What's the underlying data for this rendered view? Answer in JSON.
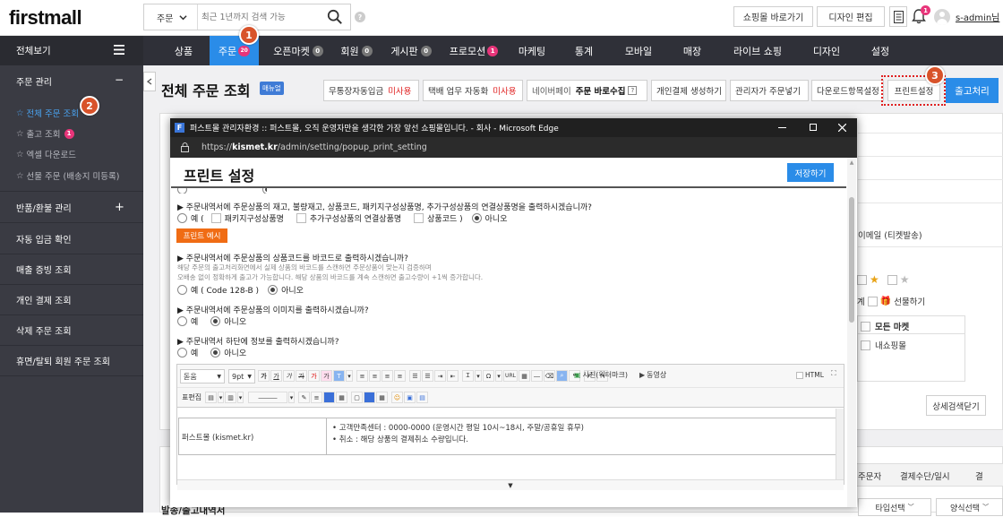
{
  "header": {
    "logo": "firstmall",
    "search_select": "주문",
    "search_placeholder": "최근 1년까지 검색 가능",
    "help": "?",
    "shop_button": "쇼핑몰 바로가기",
    "design_button": "디자인 편집",
    "notification_count": "1",
    "user": "s-admin님"
  },
  "nav": {
    "items": [
      {
        "label": "상품"
      },
      {
        "label": "주문",
        "badge": "20"
      },
      {
        "label": "오픈마켓",
        "badge": "0"
      },
      {
        "label": "회원",
        "badge": "0"
      },
      {
        "label": "게시판",
        "badge": "0"
      },
      {
        "label": "프로모션",
        "badge": "1"
      },
      {
        "label": "마케팅"
      },
      {
        "label": "통계"
      },
      {
        "label": "모바일"
      },
      {
        "label": "매장"
      },
      {
        "label": "라이브 쇼핑"
      },
      {
        "label": "디자인"
      },
      {
        "label": "설정"
      }
    ]
  },
  "sidebar": {
    "all_view": "전체보기",
    "sections": {
      "order_manage": "주문 관리",
      "order_manage_toggle": "−",
      "return_manage": "반품/환불 관리",
      "return_toggle": "+",
      "auto_deposit": "자동 입금 확인",
      "sales_proof": "매출 증빙 조회",
      "personal_payment": "개인 결제 조회",
      "deleted_orders": "삭제 주문 조회",
      "dormant_orders": "휴면/탈퇴 회원 주문 조회"
    },
    "sub_items": {
      "all_orders": "전체 주문 조회",
      "shipping": "출고 조회",
      "shipping_badge": "1",
      "excel_download": "엑셀 다운로드",
      "gift_orders": "선물 주문 (배송지 미등록)"
    }
  },
  "markers": [
    "1",
    "2",
    "3"
  ],
  "page": {
    "title": "전체 주문 조회",
    "manual_badge": "매뉴얼",
    "toolbar": {
      "no_bank_deposit": "무통장자동입금",
      "no_bank_status": "미사용",
      "courier_auto": "택배 업무 자동화",
      "courier_status": "미사용",
      "naverpay_prefix": "네이버페이",
      "naverpay_bold": "주문 바로수집",
      "naverpay_help": "?",
      "personal_payment_create": "개인결제 생성하기",
      "admin_order": "관리자가 주문넣기",
      "download_settings": "다운로드항목설정",
      "print_settings": "프린트설정",
      "shipping_process": "출고처리"
    }
  },
  "right_panel": {
    "email_ticket": "이메일 (티켓발송)",
    "gift": "선물하기",
    "all_market": "모든 마켓",
    "my_shop": "내쇼핑몰",
    "detail_search_close": "상세검색닫기",
    "col_orderer": "주문자",
    "col_payment": "결제수단/일시",
    "col_settle": "결",
    "type_select": "타입선택",
    "method_select": "양식선택"
  },
  "bottom_cut_text": "발송/출고내역서",
  "popup": {
    "window_title": "퍼스트몰 관리자환경 :: 퍼스트몰, 오직 운영자만을 생각한 가장 앞선 쇼핑몰입니다. - 회사 - Microsoft Edge",
    "url_prefix": "https://",
    "url_domain": "kismet.kr",
    "url_path": "/admin/setting/popup_print_setting",
    "title": "프린트 설정",
    "save_button": "저장하기",
    "q1": "주문내역서에 주문상품의 재고, 불량재고, 상품코드, 패키지구성상품명, 추가구성상품의 연결상품명을 출력하시겠습니까?",
    "q1_yes": "예 (",
    "q1_opt1": "패키지구성상품명",
    "q1_opt2": "추가구성상품의 연결상품명",
    "q1_opt3": "상품코드 )",
    "q1_no": "아니오",
    "print_example": "프린트 예시",
    "q2": "주문내역서에 주문상품의 상품코드를 바코드로 출력하시겠습니까?",
    "q2_note1": "해당 주문의 출고처리화면에서 실제 상품의 바코드를 스캔하면 주문상품이 맞는지 검증하며",
    "q2_note2": "오배송 없이 정확하게 출고가 가능합니다. 해당 상품의 바코드를 계속 스캔하면 출고수량이 +1씩 증가합니다.",
    "q2_yes": "예 ( Code 128-B )",
    "q2_no": "아니오",
    "q3": "주문내역서에 주문상품의 이미지를 출력하시겠습니까?",
    "q3_yes": "예",
    "q3_no": "아니오",
    "q4": "주문내역서 하단에 정보를 출력하시겠습니까?",
    "q4_yes": "예",
    "q4_no": "아니오",
    "editor": {
      "font": "돋움",
      "size": "9pt",
      "photo": "사진(워터마크)",
      "video": "동영상",
      "html_label": "HTML",
      "table_edit": "표편집",
      "url": "URL",
      "shop_name": "퍼스트몰 (kismet.kr)",
      "info1": "고객만족센터 : 0000-0000 (운영시간 평일 10시~18시, 주말/공휴일 휴무)",
      "info2": "취소 : 해당 상품의 결제취소 수량입니다.",
      "resize": "▼"
    }
  },
  "colors": {
    "nav_bg": "#2f3038",
    "sidebar_bg": "#3a3b43",
    "accent_blue": "#2a8ce8",
    "marker_orange": "#d8532a",
    "red_status": "#e02020",
    "orange_btn": "#f06c14"
  }
}
